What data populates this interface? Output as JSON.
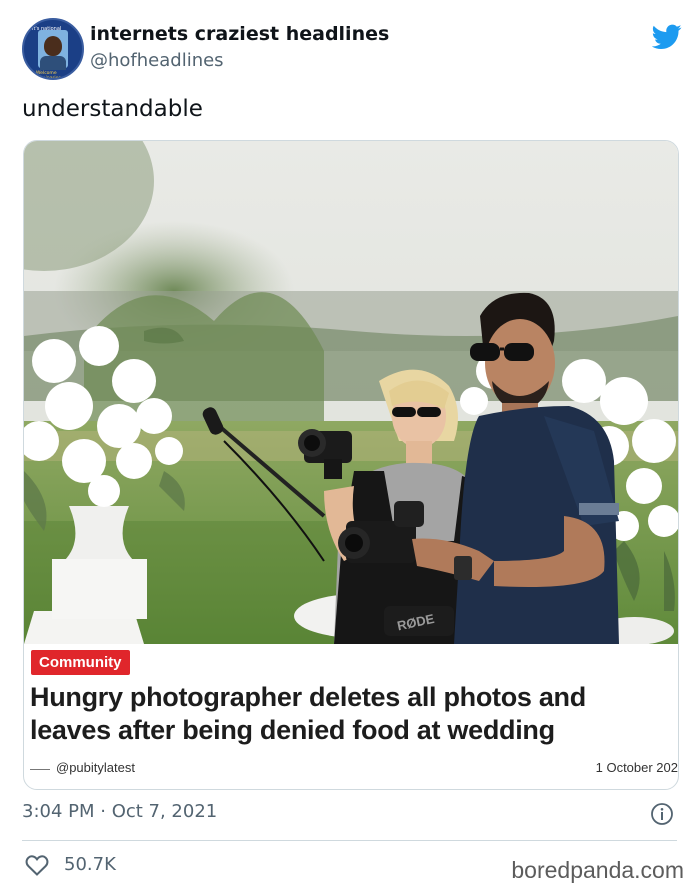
{
  "tweet": {
    "display_name": "internets craziest headlines",
    "handle": "@hofheadlines",
    "text": "understandable",
    "timestamp": "3:04 PM · Oct 7, 2021",
    "likes": "50.7K"
  },
  "avatar": {
    "top_text": "It's national",
    "bottom_text": "Welcome Luminaries"
  },
  "card": {
    "category": "Community",
    "headline": "Hungry photographer deletes all photos and leaves after being denied food at wedding",
    "source": "@pubitylatest",
    "date": "1 October 202",
    "mic_brand": "RØDE"
  },
  "watermark": "boredpanda.com",
  "icons": {
    "brand": "twitter-bird-icon",
    "info": "info-icon",
    "like": "heart-icon"
  },
  "colors": {
    "twitter_blue": "#1d9bf0",
    "category_red": "#e0262b",
    "secondary_text": "#536471"
  }
}
